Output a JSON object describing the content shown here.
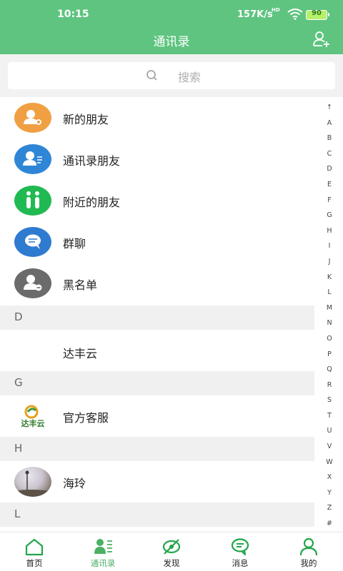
{
  "status_bar": {
    "time": "10:15",
    "network_speed": "157K/s",
    "network_type": "HD",
    "battery": "90"
  },
  "header": {
    "title": "通讯录"
  },
  "search": {
    "placeholder": "搜索"
  },
  "function_rows": [
    {
      "label": "新的朋友",
      "icon": "new-friend-icon",
      "color": "#f0a042"
    },
    {
      "label": "通讯录朋友",
      "icon": "contacts-icon",
      "color": "#2f86d6"
    },
    {
      "label": "附近的朋友",
      "icon": "nearby-icon",
      "color": "#21ba52"
    },
    {
      "label": "群聊",
      "icon": "group-chat-icon",
      "color": "#2f7bd0"
    },
    {
      "label": "黑名单",
      "icon": "blacklist-icon",
      "color": "#6b6b6b"
    }
  ],
  "sections": [
    {
      "letter": "D",
      "contacts": [
        {
          "name": "达丰云",
          "avatar": "none"
        }
      ]
    },
    {
      "letter": "G",
      "contacts": [
        {
          "name": "官方客服",
          "avatar": "logo",
          "logo_text": "达丰云"
        }
      ]
    },
    {
      "letter": "H",
      "contacts": [
        {
          "name": "海玲",
          "avatar": "photo"
        }
      ]
    },
    {
      "letter": "L",
      "contacts": []
    }
  ],
  "index_letters": [
    "↑",
    "A",
    "B",
    "C",
    "D",
    "E",
    "F",
    "G",
    "H",
    "I",
    "J",
    "K",
    "L",
    "M",
    "N",
    "O",
    "P",
    "Q",
    "R",
    "S",
    "T",
    "U",
    "V",
    "W",
    "X",
    "Y",
    "Z",
    "#"
  ],
  "tabs": [
    {
      "label": "首页",
      "icon": "home-icon",
      "active": false
    },
    {
      "label": "通讯录",
      "icon": "contacts-tab-icon",
      "active": true
    },
    {
      "label": "发现",
      "icon": "discover-icon",
      "active": false
    },
    {
      "label": "消息",
      "icon": "message-icon",
      "active": false
    },
    {
      "label": "我的",
      "icon": "profile-icon",
      "active": false
    }
  ],
  "colors": {
    "brand": "#5ec47f",
    "active_tab": "#4bb065"
  }
}
